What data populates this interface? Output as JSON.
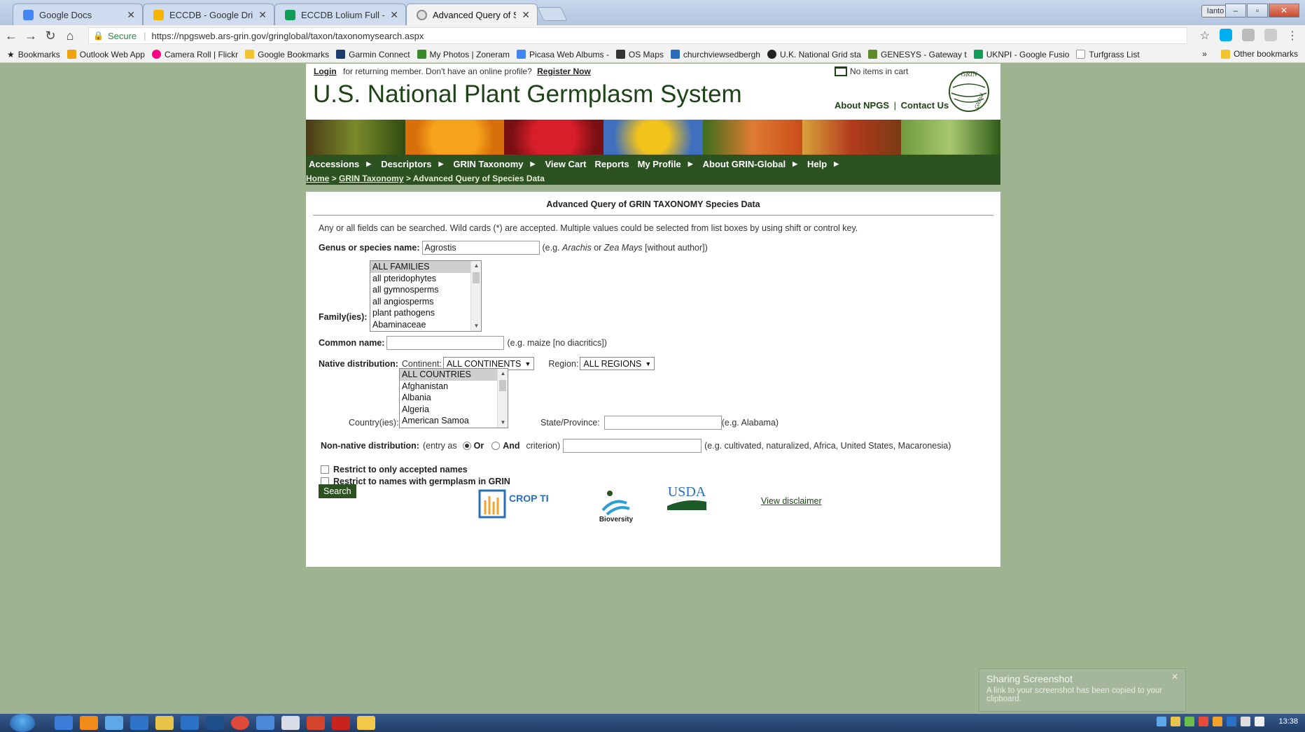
{
  "browser": {
    "tabs": [
      {
        "label": "Google Docs",
        "color": "#4285f4"
      },
      {
        "label": "ECCDB - Google Drive",
        "color": "#f4b400"
      },
      {
        "label": "ECCDB Lolium Full - Goo",
        "color": "#0f9d58"
      },
      {
        "label": "Advanced Query of Spec",
        "color": "#888888"
      }
    ],
    "profile": "Ianto",
    "secure_label": "Secure",
    "url": "https://npgsweb.ars-grin.gov/gringlobal/taxon/taxonomysearch.aspx",
    "bookmarks": [
      {
        "label": "Bookmarks",
        "color": "#555555"
      },
      {
        "label": "Outlook Web App",
        "color": "#f0a30a"
      },
      {
        "label": "Camera Roll | Flickr",
        "color": "#ff0084"
      },
      {
        "label": "Google Bookmarks",
        "color": "#f4c430"
      },
      {
        "label": "Garmin Connect",
        "color": "#1a3c6e"
      },
      {
        "label": "My Photos | Zoneram",
        "color": "#3a8a2a"
      },
      {
        "label": "Picasa Web Albums -",
        "color": "#4285f4"
      },
      {
        "label": "OS Maps",
        "color": "#333333"
      },
      {
        "label": "churchviewsedbergh",
        "color": "#2a6ebb"
      },
      {
        "label": "U.K. National Grid sta",
        "color": "#222222"
      },
      {
        "label": "GENESYS - Gateway t",
        "color": "#5a8a2a"
      },
      {
        "label": "UKNPI - Google Fusio",
        "color": "#0f9d58"
      },
      {
        "label": "Turfgrass List",
        "color": "#999999"
      }
    ],
    "other_bookmarks": "Other bookmarks",
    "more": "»"
  },
  "header": {
    "login": "Login",
    "returning_text": "for returning member. Don't have an online profile?",
    "register": "Register Now",
    "site_title": "U.S. National Plant Germplasm System",
    "cart": "No items in cart",
    "about_npgs": "About NPGS",
    "separator": "|",
    "contact_us": "Contact Us",
    "logo_text": "GRIN Global"
  },
  "nav": [
    {
      "label": "Accessions"
    },
    {
      "label": "Descriptors"
    },
    {
      "label": "GRIN Taxonomy"
    },
    {
      "label": "View Cart"
    },
    {
      "label": "Reports"
    },
    {
      "label": "My Profile"
    },
    {
      "label": "About GRIN-Global"
    },
    {
      "label": "Help"
    }
  ],
  "breadcrumb": {
    "home": "Home",
    "sep": ">",
    "taxonomy": "GRIN Taxonomy",
    "current": "Advanced Query of Species Data"
  },
  "form": {
    "title": "Advanced Query of GRIN TAXONOMY Species Data",
    "instructions": "Any or all fields can be searched. Wild cards (*) are accepted. Multiple values could be selected from list boxes by using shift or control key.",
    "genus_label": "Genus or species name:",
    "genus_value": "Agrostis",
    "genus_hint_pre": "(e.g.",
    "genus_hint_ex1": "Arachis",
    "genus_hint_or": "or",
    "genus_hint_ex2": "Zea Mays",
    "genus_hint_post": "[without author])",
    "family_label": "Family(ies):",
    "families": [
      "ALL FAMILIES",
      "all pteridophytes",
      "all gymnosperms",
      "all angiosperms",
      "plant pathogens",
      "Abaminaceae"
    ],
    "common_label": "Common name:",
    "common_value": "",
    "common_hint": "(e.g. maize [no diacritics])",
    "native_label": "Native distribution:",
    "continent_label": "Continent:",
    "continent_value": "ALL CONTINENTS",
    "region_label": "Region:",
    "region_value": "ALL REGIONS",
    "country_label": "Country(ies):",
    "countries": [
      "ALL COUNTRIES",
      "Afghanistan",
      "Albania",
      "Algeria",
      "American Samoa"
    ],
    "state_label": "State/Province:",
    "state_value": "",
    "state_hint": "(e.g. Alabama)",
    "nonnative_label": "Non-native distribution:",
    "entry_as": "(entry as",
    "or_label": "Or",
    "and_label": "And",
    "criterion": "criterion)",
    "nonnative_value": "",
    "nonnative_hint": "(e.g. cultivated, naturalized, Africa, United States, Macaronesia)",
    "restrict_accepted": "Restrict to only accepted names",
    "restrict_germplasm": "Restrict to names with germplasm in GRIN",
    "search_button": "Search"
  },
  "footer": {
    "crop_trust": "CROP TRUST",
    "bioversity": "Bioversity",
    "usda": "USDA",
    "disclaimer": "View disclaimer"
  },
  "notification": {
    "title": "Sharing Screenshot",
    "body": "A link to your screenshot has been copied to your clipboard."
  },
  "taskbar": {
    "clock": "13:38"
  }
}
